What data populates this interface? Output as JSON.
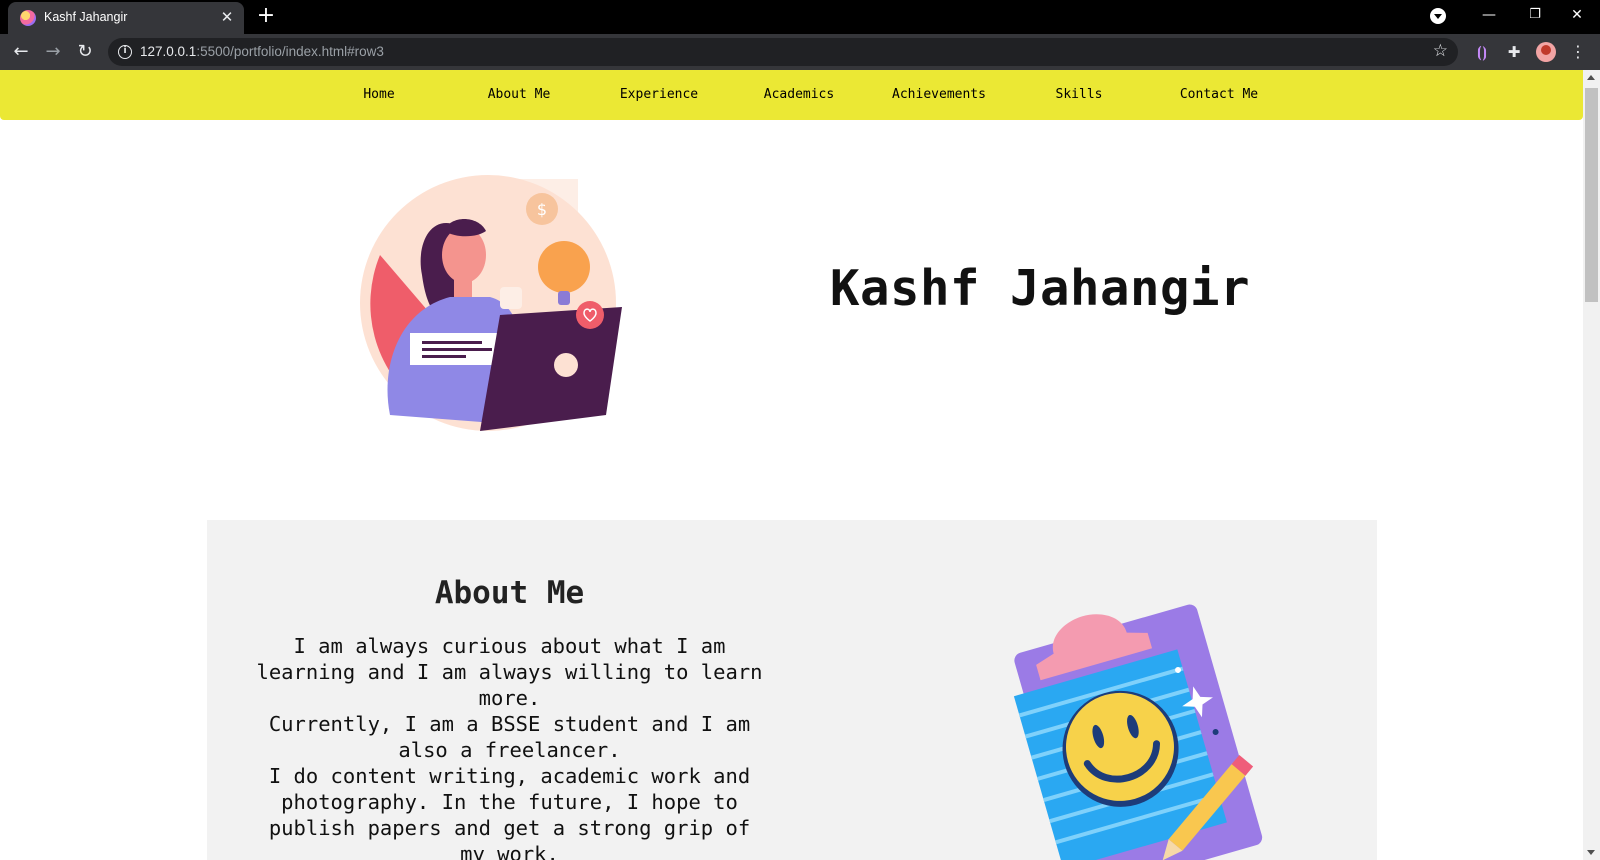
{
  "browser": {
    "tab_title": "Kashf Jahangir",
    "url_host": "127.0.0.1",
    "url_rest": ":5500/portfolio/index.html#row3"
  },
  "nav": {
    "items": [
      "Home",
      "About Me",
      "Experience",
      "Academics",
      "Achievements",
      "Skills",
      "Contact Me"
    ]
  },
  "hero": {
    "name": "Kashf Jahangir"
  },
  "about": {
    "title": "About Me",
    "lines": [
      "I am always curious about what I am",
      "learning and I am always willing to learn",
      "more.",
      "Currently, I am a BSSE student and I am",
      "also a freelancer.",
      "I do content writing, academic work and",
      "photography. In the future, I hope to",
      "publish papers and get a strong grip of",
      "my work."
    ]
  },
  "colors": {
    "navbar": "#ebe834",
    "about_bg": "#f2f2f2",
    "text": "#111111"
  },
  "icons": {
    "back": "arrow-left-icon",
    "forward": "arrow-right-icon",
    "reload": "reload-icon",
    "bookmark": "star-icon",
    "extensions": "puzzle-icon"
  }
}
